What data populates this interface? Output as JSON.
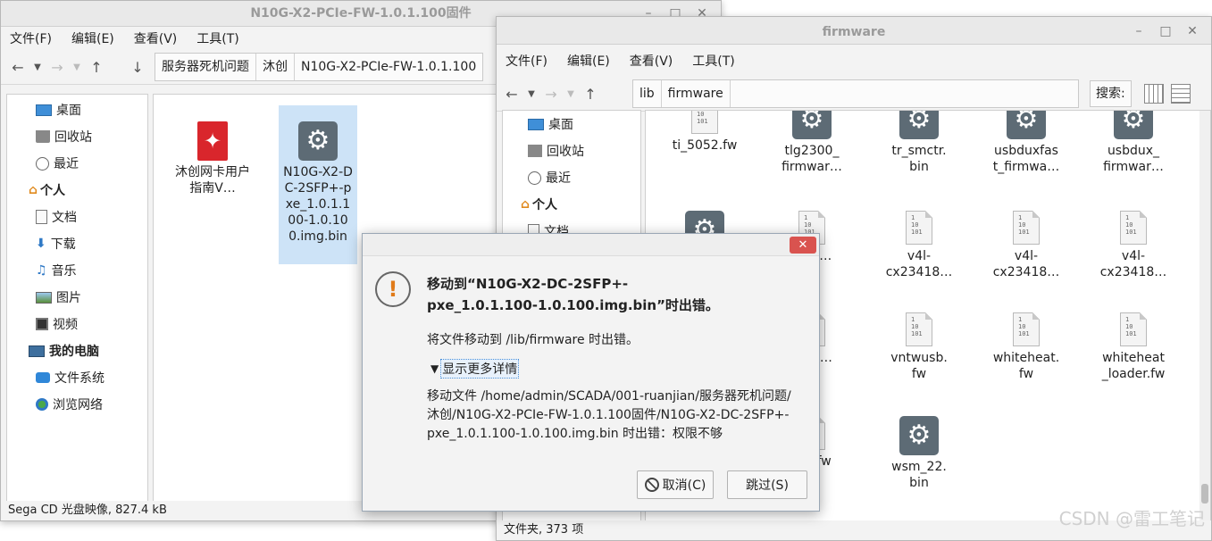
{
  "left_window": {
    "title": "N10G-X2-PCIe-FW-1.0.1.100固件",
    "menu": [
      "文件(F)",
      "编辑(E)",
      "查看(V)",
      "工具(T)"
    ],
    "breadcrumbs": [
      "服务器死机问题",
      "沐创",
      "N10G-X2-PCIe-FW-1.0.1.100"
    ],
    "sidebar": [
      {
        "label": "桌面",
        "icon": "desktop-icon",
        "header": false
      },
      {
        "label": "回收站",
        "icon": "trash-icon",
        "header": false
      },
      {
        "label": "最近",
        "icon": "clock-icon",
        "header": false
      },
      {
        "label": "个人",
        "icon": "home-icon",
        "header": true
      },
      {
        "label": "文档",
        "icon": "document-icon",
        "header": false
      },
      {
        "label": "下载",
        "icon": "download-icon",
        "header": false
      },
      {
        "label": "音乐",
        "icon": "music-icon",
        "header": false
      },
      {
        "label": "图片",
        "icon": "picture-icon",
        "header": false
      },
      {
        "label": "视频",
        "icon": "video-icon",
        "header": false
      },
      {
        "label": "我的电脑",
        "icon": "computer-icon",
        "header": true
      },
      {
        "label": "文件系统",
        "icon": "drive-icon",
        "header": false
      },
      {
        "label": "浏览网络",
        "icon": "network-icon",
        "header": false
      }
    ],
    "files": [
      {
        "name": "沐创网卡用户指南V…",
        "icon": "pdf-icon"
      },
      {
        "name": "N10G-X2-DC-2SFP+-pxe_1.0.1.100-1.0.100.img.bin",
        "icon": "gear-icon"
      }
    ],
    "status": "Sega CD 光盘映像, 827.4 kB"
  },
  "right_window": {
    "title": "firmware",
    "menu": [
      "文件(F)",
      "编辑(E)",
      "查看(V)",
      "工具(T)"
    ],
    "breadcrumbs": [
      "lib",
      "firmware"
    ],
    "search_label": "搜索:",
    "sidebar": [
      {
        "label": "桌面",
        "icon": "desktop-icon",
        "header": false
      },
      {
        "label": "回收站",
        "icon": "trash-icon",
        "header": false
      },
      {
        "label": "最近",
        "icon": "clock-icon",
        "header": false
      },
      {
        "label": "个人",
        "icon": "home-icon",
        "header": true
      },
      {
        "label": "文档",
        "icon": "document-icon",
        "header": false
      }
    ],
    "files": [
      {
        "name": "ti_5052.fw",
        "icon": "binary-icon"
      },
      {
        "name": "tlg2300_ firmwar…",
        "icon": "gear-icon"
      },
      {
        "name": "tr_smctr. bin",
        "icon": "gear-icon"
      },
      {
        "name": "usbduxfas t_firmwa…",
        "icon": "gear-icon"
      },
      {
        "name": "usbdux_ firmwar…",
        "icon": "gear-icon"
      },
      {
        "name": "",
        "icon": "gear-icon"
      },
      {
        "name": "…xx…",
        "icon": "binary-icon"
      },
      {
        "name": "v4l- cx23418…",
        "icon": "binary-icon"
      },
      {
        "name": "v4l- cx23418…",
        "icon": "binary-icon"
      },
      {
        "name": "v4l- cx23418…",
        "icon": "binary-icon"
      },
      {
        "name": "",
        "icon": "binary-icon"
      },
      {
        "name": "…40…",
        "icon": "binary-icon"
      },
      {
        "name": "vntwusb. fw",
        "icon": "binary-icon"
      },
      {
        "name": "whiteheat. fw",
        "icon": "binary-icon"
      },
      {
        "name": "whiteheat _loader.fw",
        "icon": "binary-icon"
      },
      {
        "name": "",
        "icon": "binary-icon"
      },
      {
        "name": "…0.fw",
        "icon": "binary-icon"
      },
      {
        "name": "wsm_22. bin",
        "icon": "gear-icon"
      }
    ],
    "status": "文件夹, 373 项"
  },
  "dialog": {
    "heading_line1": "移动到“N10G-X2-DC-2SFP+-",
    "heading_line2": "pxe_1.0.1.100-1.0.100.img.bin”时出错。",
    "message": "将文件移动到 /lib/firmware 时出错。",
    "details_toggle": "显示更多详情",
    "details_line1": "移动文件 /home/admin/SCADA/001-ruanjian/服务器死机问题/",
    "details_line2": "沐创/N10G-X2-PCIe-FW-1.0.1.100固件/N10G-X2-DC-2SFP+-",
    "details_line3": "pxe_1.0.1.100-1.0.100.img.bin 时出错：权限不够",
    "cancel_label": "取消(C)",
    "skip_label": "跳过(S)"
  },
  "watermark": "CSDN @雷工笔记"
}
